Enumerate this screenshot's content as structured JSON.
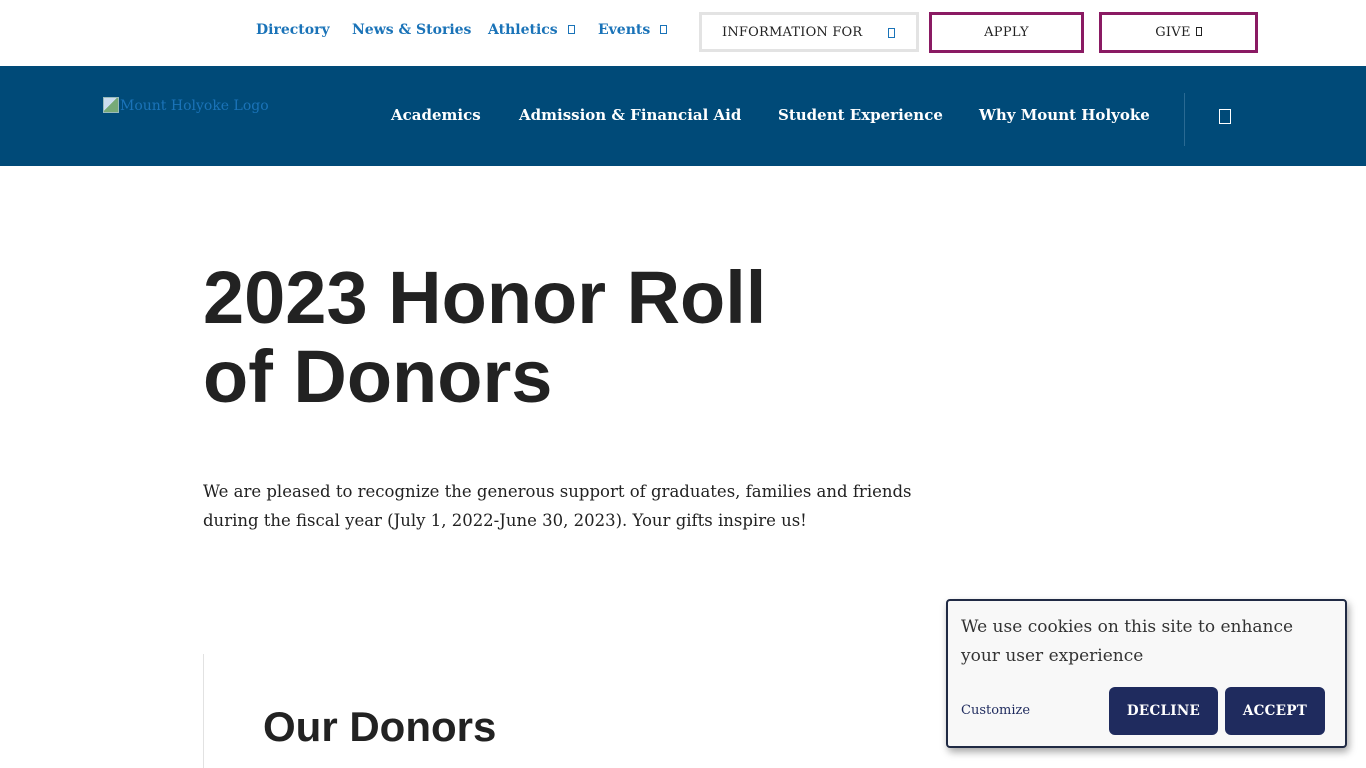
{
  "utility_nav": {
    "directory": "Directory",
    "news": "News & Stories",
    "athletics": "Athletics",
    "events": "Events",
    "info_for": "INFORMATION FOR",
    "apply": "APPLY",
    "give": "GIVE"
  },
  "colors": {
    "link_blue": "#1a73b8",
    "nav_blue": "#004a78",
    "cta_border": "#8a1a63",
    "cookie_button": "#1f2b5e"
  },
  "main_nav": {
    "logo_alt": "Mount Holyoke Logo",
    "items": [
      "Academics",
      "Admission & Financial Aid",
      "Student Experience",
      "Why Mount Holyoke"
    ],
    "search_icon": "search-icon"
  },
  "hero": {
    "title_line1": "2023 Honor Roll",
    "title_line2": "of Donors",
    "intro": "We are pleased to recognize the generous support of graduates, families and friends during the fiscal year (July 1, 2022-June 30, 2023). Your gifts inspire us!"
  },
  "section": {
    "title": "Our Donors"
  },
  "cookie_banner": {
    "message": "We use cookies on this site to enhance your user experience",
    "customize": "Customize",
    "decline": "DECLINE",
    "accept": "ACCEPT"
  }
}
